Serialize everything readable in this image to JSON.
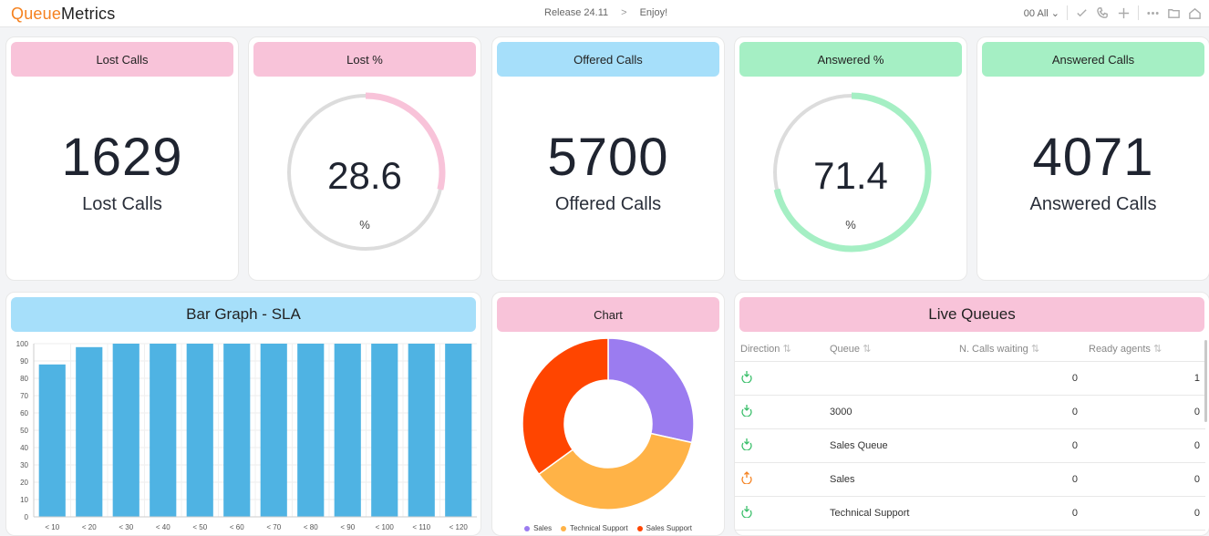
{
  "app": {
    "logo_part1": "Queue",
    "logo_part2": "Metrics"
  },
  "header": {
    "release": "Release 24.11",
    "separator": ">",
    "tagline": "Enjoy!",
    "filter_value": "00 All"
  },
  "kpis": {
    "lost_calls": {
      "title": "Lost Calls",
      "value": "1629",
      "label": "Lost Calls"
    },
    "lost_pct": {
      "title": "Lost %",
      "value": "28.6",
      "unit": "%",
      "fraction": 0.286,
      "color": "#f8c3d9"
    },
    "offered_calls": {
      "title": "Offered Calls",
      "value": "5700",
      "label": "Offered Calls"
    },
    "answered_pct": {
      "title": "Answered %",
      "value": "71.4",
      "unit": "%",
      "fraction": 0.714,
      "color": "#a5efc4"
    },
    "answered_calls": {
      "title": "Answered Calls",
      "value": "4071",
      "label": "Answered Calls"
    }
  },
  "bar_card": {
    "title": "Bar Graph - SLA"
  },
  "donut_card": {
    "title": "Chart"
  },
  "chart_data": [
    {
      "type": "bar",
      "categories": [
        "< 10",
        "< 20",
        "< 30",
        "< 40",
        "< 50",
        "< 60",
        "< 70",
        "< 80",
        "< 90",
        "< 100",
        "< 110",
        "< 120"
      ],
      "values": [
        88,
        98,
        100,
        100,
        100,
        100,
        100,
        100,
        100,
        100,
        100,
        100
      ],
      "ylim": [
        0,
        100
      ],
      "yticks": [
        0,
        10,
        20,
        30,
        40,
        50,
        60,
        70,
        80,
        90,
        100
      ],
      "color": "#4fb3e3",
      "title": "",
      "xlabel": "",
      "ylabel": ""
    },
    {
      "type": "pie",
      "categories": [
        "Sales",
        "Technical Support",
        "Sales Support"
      ],
      "values": [
        28.5,
        36.5,
        35.0
      ],
      "colors": [
        "#9b7cf0",
        "#ffb347",
        "#ff4500"
      ]
    }
  ],
  "live_queues": {
    "title": "Live Queues",
    "columns": [
      "Direction",
      "Queue",
      "N. Calls waiting",
      "Ready agents"
    ],
    "rows": [
      {
        "direction": "inbound",
        "queue": "",
        "waiting": "0",
        "agents": "1"
      },
      {
        "direction": "inbound",
        "queue": "3000",
        "waiting": "0",
        "agents": "0"
      },
      {
        "direction": "inbound",
        "queue": "Sales Queue",
        "waiting": "0",
        "agents": "0"
      },
      {
        "direction": "outbound",
        "queue": "Sales",
        "waiting": "0",
        "agents": "0"
      },
      {
        "direction": "inbound",
        "queue": "Technical Support",
        "waiting": "0",
        "agents": "0"
      }
    ],
    "colors": {
      "inbound": "#3bbf6b",
      "outbound": "#f58220"
    }
  }
}
